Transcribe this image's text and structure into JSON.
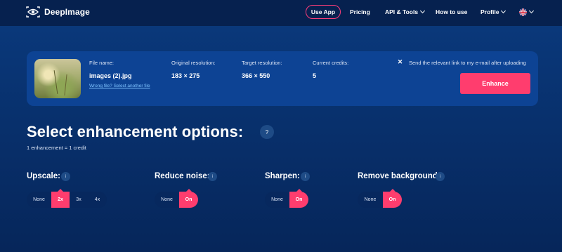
{
  "nav": {
    "logo_text": "DeepImage",
    "use_app": "Use App",
    "pricing": "Pricing",
    "api_tools": "API & Tools",
    "how_to_use": "How to use",
    "profile": "Profile"
  },
  "file": {
    "name_label": "File name:",
    "name": "images (2).jpg",
    "wrong_file_link": "Wrong file? Select another file",
    "orig_label": "Original resolution:",
    "orig_value": "183 × 275",
    "target_label": "Target resolution:",
    "target_value": "366 × 550",
    "credits_label": "Current credits:",
    "credits_value": "5",
    "email_checkbox_label": "Send the relevant link to my e-mail after uploading",
    "enhance_label": "Enhance"
  },
  "heading": {
    "title": "Select enhancement options:",
    "help": "?",
    "subtitle": "1 enhancement = 1 credit"
  },
  "options": {
    "info_glyph": "i",
    "upscale": {
      "title": "Upscale:",
      "choices": [
        "None",
        "2x",
        "3x",
        "4x"
      ],
      "selected": "2x"
    },
    "reduce_noise": {
      "title": "Reduce noise:",
      "choices": [
        "None",
        "On"
      ],
      "selected": "On"
    },
    "sharpen": {
      "title": "Sharpen:",
      "choices": [
        "None",
        "On"
      ],
      "selected": "On"
    },
    "remove_background": {
      "title": "Remove background:",
      "choices": [
        "None",
        "On"
      ],
      "selected": "On"
    }
  },
  "colors": {
    "accent": "#ff3d6e",
    "nav_bg": "#06214f",
    "page_bg": "#0a3a7e",
    "card_bg": "#0d4394",
    "link": "#7fc3ff"
  }
}
